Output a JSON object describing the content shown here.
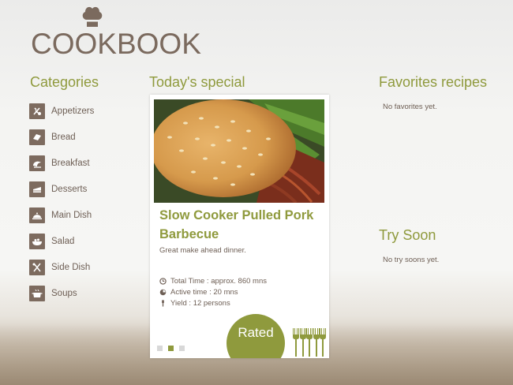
{
  "app": {
    "logo_text": "COOKBOOK"
  },
  "colors": {
    "accent": "#8f9a3d",
    "brown": "#7d6b5f",
    "text": "#6e5f55"
  },
  "categories": {
    "title": "Categories",
    "items": [
      {
        "label": "Appetizers",
        "icon": "appetizers-icon"
      },
      {
        "label": "Bread",
        "icon": "bread-icon"
      },
      {
        "label": "Breakfast",
        "icon": "breakfast-icon"
      },
      {
        "label": "Desserts",
        "icon": "cake-icon"
      },
      {
        "label": "Main Dish",
        "icon": "cloche-icon"
      },
      {
        "label": "Salad",
        "icon": "salad-bowl-icon"
      },
      {
        "label": "Side Dish",
        "icon": "side-dish-icon"
      },
      {
        "label": "Soups",
        "icon": "soup-pot-icon"
      }
    ]
  },
  "special": {
    "title": "Today's special",
    "recipe_title": "Slow Cooker Pulled Pork Barbecue",
    "description": "Great make ahead dinner.",
    "total_time": "Total Time : approx. 860 mns",
    "active_time": "Active time : 20 mns",
    "yield": "Yield : 12 persons",
    "rated_label": "Rated",
    "rating": 5,
    "rating_max": 5,
    "carousel_pages": 3,
    "carousel_active": 2
  },
  "favorites": {
    "title": "Favorites recipes",
    "empty": "No favorites yet."
  },
  "try_soon": {
    "title": "Try Soon",
    "empty": "No try soons yet."
  }
}
